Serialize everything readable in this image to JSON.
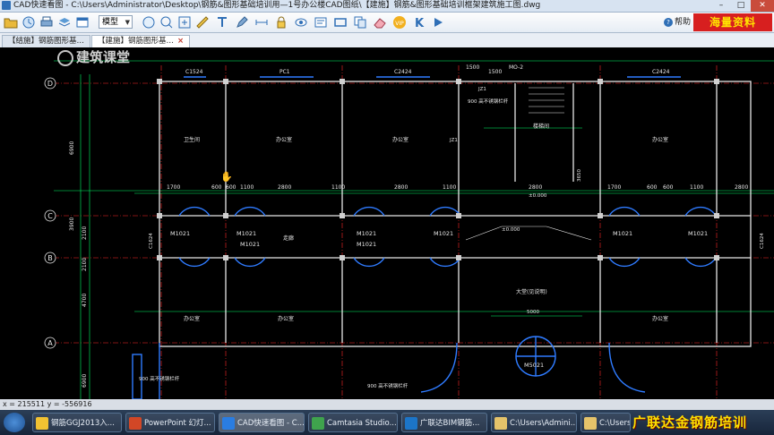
{
  "window": {
    "title": "CAD快速看图 - C:\\Users\\Administrator\\Desktop\\钢筋&图形基础培训用—1号办公楼CAD图纸\\【建施】钢筋&图形基础培训框架建筑施工图.dwg",
    "min": "–",
    "max": "□",
    "close": "✕"
  },
  "toolbar": {
    "model_select": "模型",
    "help_label": "帮助",
    "icons": [
      "open-folder-icon",
      "recent-icon",
      "print-icon",
      "layers-icon",
      "zoom-window-icon",
      "text-icon",
      "measure-icon",
      "pen-icon",
      "eye-icon",
      "lock-icon",
      "text-edit-icon",
      "rectangle-icon",
      "copy-icon",
      "erase-icon",
      "vip-icon",
      "k-icon",
      "arrow-icon"
    ]
  },
  "banner": "海量资料",
  "tabs": [
    {
      "label": "【结施】钢筋图形基…",
      "active": false
    },
    {
      "label": "【建施】钢筋图形基…",
      "active": true,
      "close": "×"
    }
  ],
  "watermark": "建筑课堂",
  "drawing": {
    "axis_letters": [
      "D",
      "C",
      "B",
      "A"
    ],
    "dims_top": [
      "C1524",
      "PC1",
      "C2424",
      "1500",
      "1500",
      "MO-2",
      "C2424"
    ],
    "dims_row": [
      "1700",
      "600",
      "600",
      "1100",
      "2800",
      "1100",
      "2800",
      "1100",
      "2800",
      "1700",
      "600",
      "600",
      "1100",
      "2800"
    ],
    "door_labels": [
      "M1021",
      "M1021",
      "M1021",
      "M1021",
      "M1021",
      "M1021",
      "M1021",
      "M1021"
    ],
    "door_bottom": "M5021",
    "side_dims": [
      "6900",
      "3900",
      "2100",
      "2100",
      "4700",
      "6900"
    ],
    "notes": [
      "900 高不锈钢栏杆",
      "900 高不锈钢栏杆",
      "900 高不锈钢栏杆",
      "5000",
      "±0.000",
      "3650",
      "JZ1",
      "JZ1",
      "C1624",
      "C1624",
      "±0.000"
    ],
    "rooms": [
      "卫生间",
      "办公室",
      "办公室",
      "办公室",
      "办公室",
      "办公室",
      "办公室",
      "走廊",
      "大堂(见说明)",
      "楼梯间"
    ]
  },
  "status": "x = 215511 y = -556916",
  "taskbar": {
    "items": [
      {
        "label": "钢筋GGJ2013入...",
        "color": "#f1c232"
      },
      {
        "label": "PowerPoint 幻灯...",
        "color": "#d24726"
      },
      {
        "label": "CAD快速看图 - C...",
        "color": "#2a7de1"
      },
      {
        "label": "Camtasia Studio...",
        "color": "#3fa34d"
      },
      {
        "label": "广联达BIM钢筋...",
        "color": "#1c75c8"
      },
      {
        "label": "C:\\Users\\Admini...",
        "color": "#e5c36a"
      },
      {
        "label": "C:\\Users\\Admini...",
        "color": "#e5c36a"
      }
    ],
    "tray": "广联达金钢筋培训"
  },
  "colors": {
    "drawing_bg": "#000000",
    "wall": "#ffffff",
    "dim": "#00ff66",
    "axis": "#ff2a2a",
    "accent": "#2f7bff"
  }
}
